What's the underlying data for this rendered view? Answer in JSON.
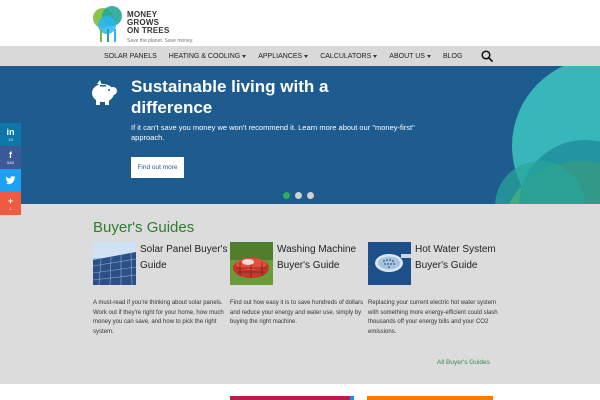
{
  "brand": {
    "name_line1": "MONEY",
    "name_line2": "GROWS",
    "name_line3": "ON TREES",
    "tagline": "Save the planet. Save money."
  },
  "nav": {
    "items": [
      {
        "label": "SOLAR PANELS",
        "has_dropdown": false
      },
      {
        "label": "HEATING & COOLING",
        "has_dropdown": true
      },
      {
        "label": "APPLIANCES",
        "has_dropdown": true
      },
      {
        "label": "CALCULATORS",
        "has_dropdown": true
      },
      {
        "label": "ABOUT US",
        "has_dropdown": true
      },
      {
        "label": "BLOG",
        "has_dropdown": false
      }
    ],
    "search_icon": "search-icon"
  },
  "hero": {
    "title": "Sustainable living with a difference",
    "text": "If it can't save you money we won't recommend it. Learn more about our \"money-first\" approach.",
    "button_label": "Find out more",
    "icon": "piggy-bank-icon",
    "slides": 3,
    "active_slide": 1
  },
  "social": [
    {
      "network": "linkedin",
      "glyph": "in",
      "count": "13"
    },
    {
      "network": "facebook",
      "glyph": "f",
      "count": "540"
    },
    {
      "network": "twitter",
      "glyph": "t",
      "count": ""
    },
    {
      "network": "more",
      "glyph": "+",
      "count": "1"
    }
  ],
  "guides": {
    "title": "Buyer's Guides",
    "items": [
      {
        "title": "Solar Panel Buyer's Guide",
        "description": "A must-read if you're thinking about solar panels. Work out if they're right for your home, how much money you can save, and how to pick the right system."
      },
      {
        "title": "Washing Machine Buyer's Guide",
        "description": "Find out how easy it is to save hundreds of dollars and reduce your energy and water use, simply by buying the right machine."
      },
      {
        "title": "Hot Water System Buyer's Guide",
        "description": "Replacing your current electric hot water system with something more energy-efficient could slash thousands off your energy bills and your CO2 emissions."
      }
    ],
    "all_link": "All Buyer's Guides"
  },
  "colors": {
    "hero_bg": "#1e5c8f",
    "accent_green": "#2e7d32",
    "link_green": "#2e8b57"
  }
}
